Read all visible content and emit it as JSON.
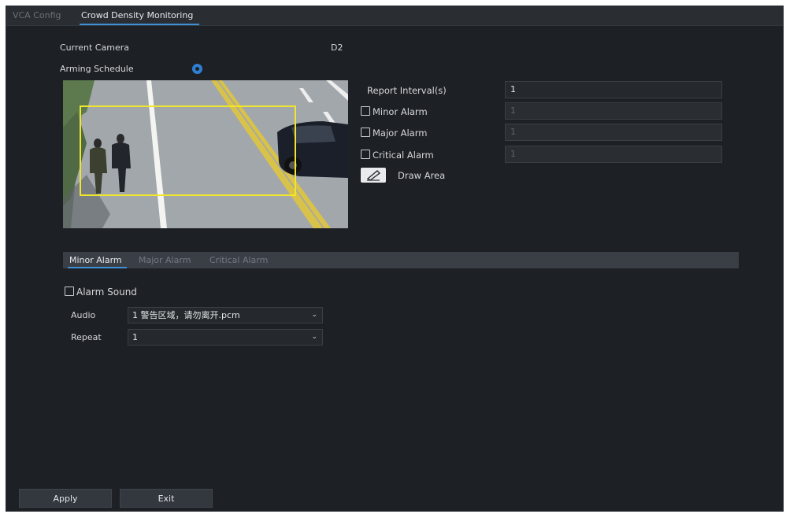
{
  "tabs": {
    "vca_config": "VCA Config",
    "crowd_density": "Crowd Density Monitoring"
  },
  "camera": {
    "label": "Current Camera",
    "value": "D2"
  },
  "schedule": {
    "label": "Arming Schedule",
    "icon": "gear-icon"
  },
  "report": {
    "label": "Report Interval(s)",
    "value": "1"
  },
  "alarms": {
    "minor": {
      "label": "Minor Alarm",
      "value": "1",
      "checked": false
    },
    "major": {
      "label": "Major Alarm",
      "value": "1",
      "checked": false
    },
    "critical": {
      "label": "Critical Alarm",
      "value": "1",
      "checked": false
    }
  },
  "draw_area": {
    "label": "Draw Area",
    "icon": "pencil-icon"
  },
  "alarm_tabs": {
    "minor": "Minor Alarm",
    "major": "Major Alarm",
    "critical": "Critical Alarm"
  },
  "alarm_sound": {
    "label": "Alarm Sound",
    "checked": false
  },
  "audio": {
    "label": "Audio",
    "value": "1 警告区域，请勿离开.pcm"
  },
  "repeat": {
    "label": "Repeat",
    "value": "1"
  },
  "buttons": {
    "apply": "Apply",
    "exit": "Exit"
  },
  "colors": {
    "accent": "#3d8fd6",
    "region": "#f0e62a",
    "background": "#1d2024"
  }
}
